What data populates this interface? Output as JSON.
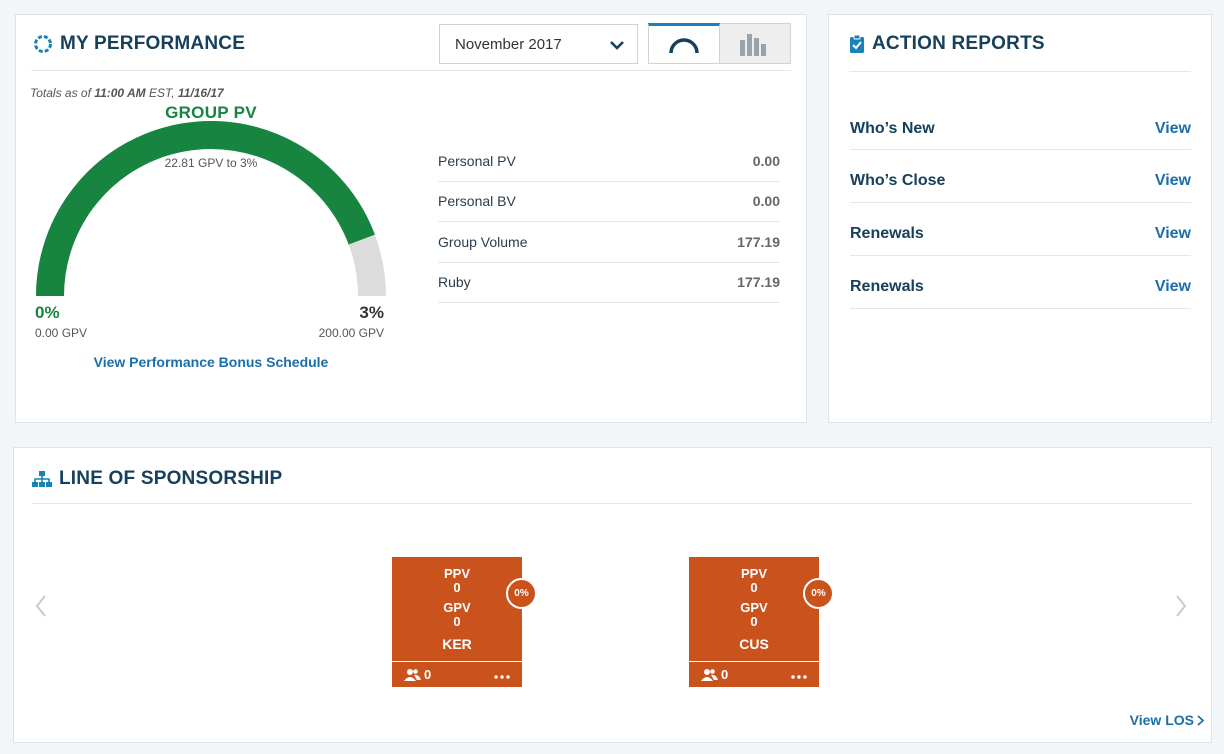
{
  "performance": {
    "title": "MY PERFORMANCE",
    "month_selected": "November 2017",
    "totals_prefix": "Totals as of",
    "totals_time": "11:00 AM",
    "totals_zone": "EST,",
    "totals_date": "11/16/17",
    "gauge": {
      "label": "GROUP PV",
      "value": "177.19",
      "sub": "22.81 GPV to 3%",
      "min_pct": "0%",
      "min_gpv": "0.00 GPV",
      "max_pct": "3%",
      "max_gpv": "200.00 GPV",
      "fraction": 0.886,
      "fill_color": "#178440",
      "track_color": "#dcdcdc"
    },
    "bonus_link": "View Performance Bonus Schedule",
    "stats": [
      {
        "label": "Personal PV",
        "value": "0.00"
      },
      {
        "label": "Personal BV",
        "value": "0.00"
      },
      {
        "label": "Group Volume",
        "value": "177.19"
      },
      {
        "label": "Ruby",
        "value": "177.19"
      }
    ]
  },
  "action_reports": {
    "title": "ACTION REPORTS",
    "items": [
      {
        "name": "Who’s New",
        "link": "View"
      },
      {
        "name": "Who’s Close",
        "link": "View"
      },
      {
        "name": "Renewals",
        "link": "View"
      },
      {
        "name": "Renewals",
        "link": "View"
      }
    ]
  },
  "sponsorship": {
    "title": "LINE OF SPONSORSHIP",
    "nodes": [
      {
        "ppv_label": "PPV",
        "ppv": "0",
        "gpv_label": "GPV",
        "gpv": "0",
        "name": "KER",
        "pct": "0%",
        "count": "0"
      },
      {
        "ppv_label": "PPV",
        "ppv": "0",
        "gpv_label": "GPV",
        "gpv": "0",
        "name": "CUS",
        "pct": "0%",
        "count": "0"
      }
    ],
    "view_los": "View LOS"
  },
  "colors": {
    "accent": "#1b6ea8",
    "heading": "#17405a",
    "success": "#178440",
    "node": "#c9521d"
  }
}
